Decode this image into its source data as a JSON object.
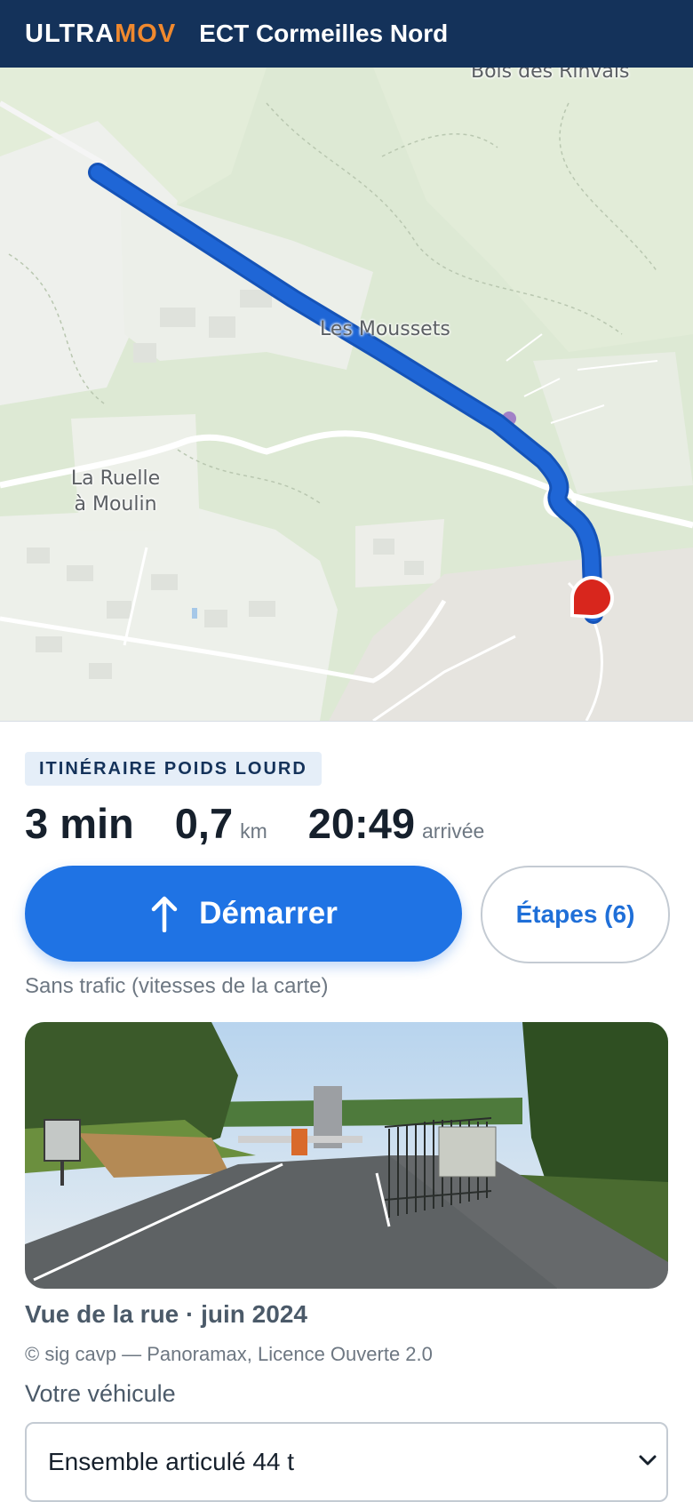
{
  "header": {
    "brand_primary": "ULTRA",
    "brand_accent": "MOV",
    "site_title": "ECT Cormeilles Nord"
  },
  "map": {
    "labels": {
      "bois": "Bois des Rinvals",
      "moussets": "Les Moussets",
      "ruelle": "La Ruelle à Moulin"
    },
    "route_color": "#1f66d6",
    "destination_pin_color": "#d8261d"
  },
  "route": {
    "badge": "ITINÉRAIRE POIDS LOURD",
    "duration": "3 min",
    "distance_value": "0,7",
    "distance_unit": "km",
    "arrival_time": "20:49",
    "arrival_label": "arrivée",
    "start_label": "Démarrer",
    "start_icon": "arrow-up-icon",
    "steps_label": "Étapes (6)",
    "traffic_note": "Sans trafic (vitesses de la carte)"
  },
  "street_view": {
    "caption": "Vue de la rue · juin 2024",
    "credit": "© sig cavp — Panoramax, Licence Ouverte 2.0"
  },
  "vehicle": {
    "label": "Votre véhicule",
    "selected": "Ensemble articulé 44 t",
    "icon": "chevron-down-icon"
  },
  "colors": {
    "header_bg": "#14325a",
    "brand_accent": "#f0892e",
    "primary_button": "#1f73e4",
    "steps_text": "#1f6fd8"
  }
}
